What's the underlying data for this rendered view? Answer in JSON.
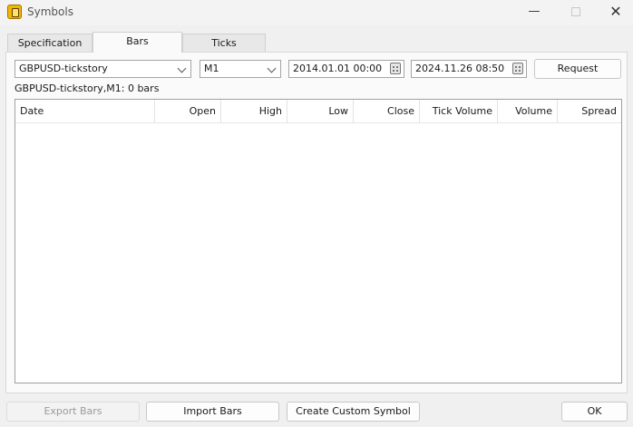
{
  "window": {
    "title": "Symbols",
    "minimize_glyph": "—",
    "close_glyph": "✕"
  },
  "tabs": [
    {
      "label": "Specification",
      "active": false
    },
    {
      "label": "Bars",
      "active": true
    },
    {
      "label": "Ticks",
      "active": false
    }
  ],
  "controls": {
    "symbol": "GBPUSD-tickstory",
    "timeframe": "M1",
    "date_from": "2014.01.01 00:00",
    "date_to": "2024.11.26 08:50",
    "request_label": "Request"
  },
  "status": "GBPUSD-tickstory,M1: 0 bars",
  "table": {
    "columns": [
      "Date",
      "Open",
      "High",
      "Low",
      "Close",
      "Tick Volume",
      "Volume",
      "Spread"
    ],
    "rows": []
  },
  "footer": {
    "export_label": "Export Bars",
    "import_label": "Import Bars",
    "custom_label": "Create Custom Symbol",
    "ok_label": "OK"
  },
  "colors": {
    "background": "#f0f0f0",
    "panel": "#fafafa",
    "app_icon": "#f2b705"
  },
  "icons": {
    "app": "symbols-app-icon",
    "calendar": "calendar-icon",
    "dropdown": "chevron-down-icon"
  }
}
